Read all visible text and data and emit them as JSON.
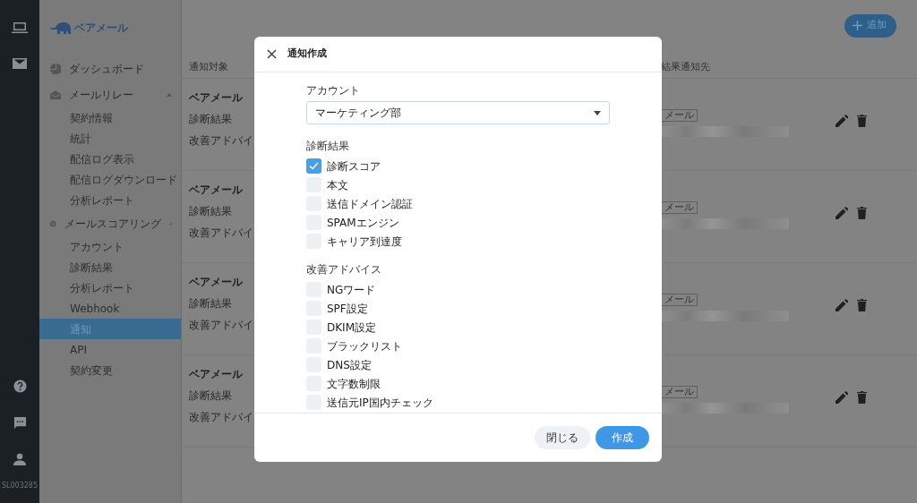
{
  "rail": {
    "account_id": "SL003285"
  },
  "sidebar": {
    "logo": "ベアメール",
    "items": [
      {
        "label": "ダッシュボード"
      },
      {
        "label": "メールリレー",
        "expanded": true,
        "children": [
          {
            "label": "契約情報",
            "selected": false
          },
          {
            "label": "統計",
            "selected": false
          },
          {
            "label": "配信ログ表示",
            "selected": false
          },
          {
            "label": "配信ログダウンロード",
            "selected": false
          },
          {
            "label": "分析レポート",
            "selected": false
          }
        ]
      },
      {
        "label": "メールスコアリング",
        "expanded": true,
        "children": [
          {
            "label": "アカウント",
            "selected": false
          },
          {
            "label": "診断結果",
            "selected": false
          },
          {
            "label": "分析レポート",
            "selected": false
          },
          {
            "label": "Webhook",
            "selected": false
          },
          {
            "label": "通知",
            "selected": true
          },
          {
            "label": "API",
            "selected": false
          },
          {
            "label": "契約変更",
            "selected": false
          }
        ]
      }
    ]
  },
  "add_button": "追加",
  "table": {
    "columns": [
      "通知対象",
      "結果通知先"
    ],
    "rows": [
      {
        "title": "ベアメール",
        "line_1": "診断結果",
        "line_2": "改善アドバイ",
        "channel": "メール"
      },
      {
        "title": "ベアメール",
        "line_1": "診断結果",
        "line_2": "改善アドバイ",
        "channel": "メール"
      },
      {
        "title": "ベアメール",
        "line_1": "診断結果",
        "line_2": "改善アドバイ",
        "channel": "メール"
      },
      {
        "title": "ベアメール",
        "line_1": "診断結果",
        "line_2": "改善アドバイ",
        "channel": "メール"
      }
    ]
  },
  "modal": {
    "title": "通知作成",
    "account_label": "アカウント",
    "account_value": "マーケティング部",
    "sections": [
      {
        "label": "診断結果",
        "options": [
          {
            "label": "診断スコア",
            "checked": true
          },
          {
            "label": "本文",
            "checked": false
          },
          {
            "label": "送信ドメイン認証",
            "checked": false
          },
          {
            "label": "SPAMエンジン",
            "checked": false
          },
          {
            "label": "キャリア到達度",
            "checked": false
          }
        ]
      },
      {
        "label": "改善アドバイス",
        "options": [
          {
            "label": "NGワード",
            "checked": false
          },
          {
            "label": "SPF設定",
            "checked": false
          },
          {
            "label": "DKIM設定",
            "checked": false
          },
          {
            "label": "ブラックリスト",
            "checked": false
          },
          {
            "label": "DNS設定",
            "checked": false
          },
          {
            "label": "文字数制限",
            "checked": false
          },
          {
            "label": "送信元IP国内チェック",
            "checked": false
          }
        ]
      }
    ],
    "buttons": [
      {
        "label": "閉じる",
        "kind": "secondary"
      },
      {
        "label": "作成",
        "kind": "primary"
      }
    ]
  }
}
